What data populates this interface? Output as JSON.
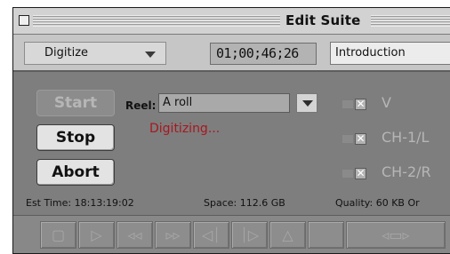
{
  "window": {
    "title": "Edit Suite"
  },
  "toolbar": {
    "mode": "Digitize",
    "timecode": "01;00;46;26",
    "clip_name": "Introduction"
  },
  "buttons": {
    "start": "Start",
    "stop": "Stop",
    "abort": "Abort"
  },
  "reel": {
    "label": "Reel:",
    "value": "A roll"
  },
  "status": "Digitizing...",
  "tracks": [
    {
      "label": "V",
      "checked": true
    },
    {
      "label": "CH-1/L",
      "checked": true
    },
    {
      "label": "CH-2/R",
      "checked": true
    }
  ],
  "info": {
    "est_time": "Est Time: 18:13:19:02",
    "space": "Space: 112.6 GB",
    "quality": "Quality: 60 KB Or"
  },
  "transport": [
    {
      "name": "stop-icon",
      "glyph": "▢"
    },
    {
      "name": "play-icon",
      "glyph": "▷"
    },
    {
      "name": "rewind-icon",
      "glyph": "◃◃"
    },
    {
      "name": "fast-forward-icon",
      "glyph": "▹▹"
    },
    {
      "name": "step-back-icon",
      "glyph": "◁⏐"
    },
    {
      "name": "step-forward-icon",
      "glyph": "⏐▷"
    },
    {
      "name": "eject-icon",
      "glyph": "△"
    },
    {
      "name": "shuttle-icon",
      "glyph": "◃▭▹"
    }
  ]
}
